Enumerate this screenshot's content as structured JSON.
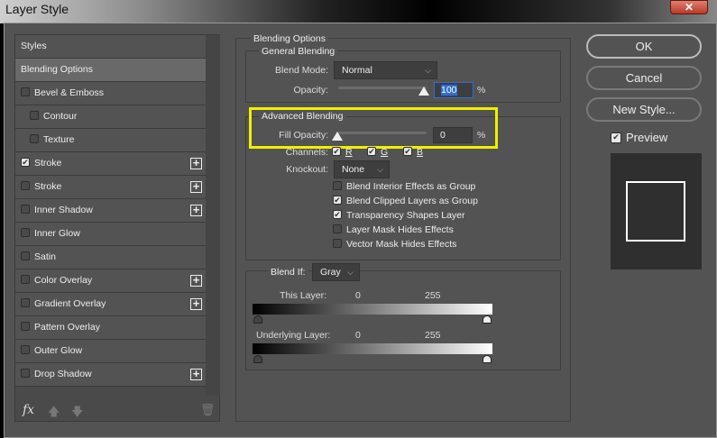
{
  "window": {
    "title": "Layer Style",
    "close": "✕"
  },
  "styles_list": {
    "header": "Styles",
    "items": [
      {
        "label": "Blending Options",
        "selected": true
      },
      {
        "label": "Bevel & Emboss",
        "checked": false
      },
      {
        "label": "Contour",
        "checked": false,
        "indent": true
      },
      {
        "label": "Texture",
        "checked": false,
        "indent": true
      },
      {
        "label": "Stroke",
        "checked": true,
        "plus": true
      },
      {
        "label": "Stroke",
        "checked": false,
        "plus": true
      },
      {
        "label": "Inner Shadow",
        "checked": false,
        "plus": true
      },
      {
        "label": "Inner Glow",
        "checked": false
      },
      {
        "label": "Satin",
        "checked": false
      },
      {
        "label": "Color Overlay",
        "checked": false,
        "plus": true
      },
      {
        "label": "Gradient Overlay",
        "checked": false,
        "plus": true
      },
      {
        "label": "Pattern Overlay",
        "checked": false
      },
      {
        "label": "Outer Glow",
        "checked": false
      },
      {
        "label": "Drop Shadow",
        "checked": false,
        "plus": true
      }
    ],
    "fx_label": "fx"
  },
  "blending": {
    "title": "Blending Options",
    "general": {
      "title": "General Blending",
      "blend_mode_label": "Blend Mode:",
      "blend_mode": "Normal",
      "opacity_label": "Opacity:",
      "opacity": "100",
      "pct": "%"
    },
    "advanced": {
      "title": "Advanced Blending",
      "fill_label": "Fill Opacity:",
      "fill": "0",
      "pct": "%",
      "channels_label": "Channels:",
      "channels": [
        "R",
        "G",
        "B"
      ],
      "knockout_label": "Knockout:",
      "knockout": "None",
      "options": [
        {
          "label": "Blend Interior Effects as Group",
          "checked": false
        },
        {
          "label": "Blend Clipped Layers as Group",
          "checked": true
        },
        {
          "label": "Transparency Shapes Layer",
          "checked": true
        },
        {
          "label": "Layer Mask Hides Effects",
          "checked": false
        },
        {
          "label": "Vector Mask Hides Effects",
          "checked": false
        }
      ]
    },
    "blend_if": {
      "label": "Blend If:",
      "value": "Gray",
      "this_layer": "This Layer:",
      "underlying": "Underlying Layer:",
      "min": "0",
      "max": "255"
    }
  },
  "buttons": {
    "ok": "OK",
    "cancel": "Cancel",
    "new_style": "New Style...",
    "preview": "Preview"
  },
  "highlight_color": "#f0f000"
}
